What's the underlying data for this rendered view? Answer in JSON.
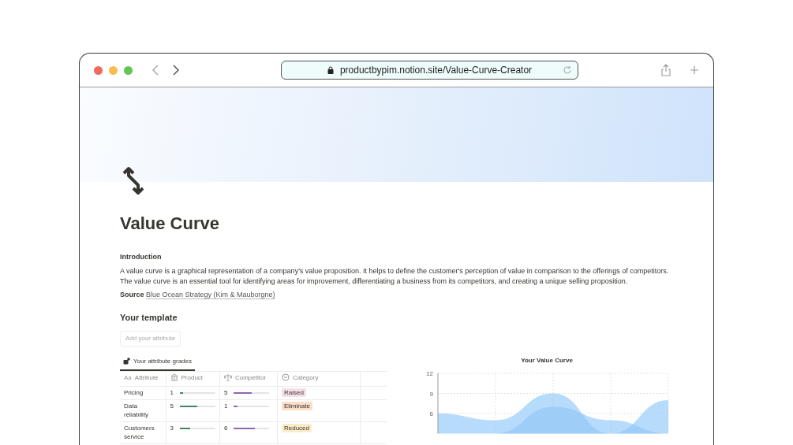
{
  "browser": {
    "url": "productbypim.notion.site/Value-Curve-Creator"
  },
  "page": {
    "title": "Value Curve",
    "intro_heading": "Introduction",
    "intro_text": "A value curve is a graphical representation of a company's value proposition. It helps to define the customer's perception of value in comparison to the offerings of competitors. The value curve is an essential tool for identifying areas for improvement, differentiating a business from its competitors, and creating a unique selling proposition.",
    "source_label": "Source",
    "source_link": "Blue Ocean Strategy (Kim & Mauborgne)"
  },
  "template": {
    "heading": "Your template",
    "button": "Add your attribute",
    "view_tab": "Your attribute grades",
    "columns": [
      {
        "glyph": "Aa",
        "label": "Attribute"
      },
      {
        "label": "Product"
      },
      {
        "label": "Competitor"
      },
      {
        "label": "Category"
      }
    ],
    "rows": [
      {
        "attribute": "Pricing",
        "product": {
          "value": "1",
          "level": 0.1
        },
        "competitor": {
          "value": "5",
          "level": 0.5
        },
        "category": "Raised",
        "color": "#f5e0e9"
      },
      {
        "attribute": "Data reliability",
        "product": {
          "value": "5",
          "level": 0.5
        },
        "competitor": {
          "value": "1",
          "level": 0.1
        },
        "category": "Eliminate",
        "color": "#fadec9"
      },
      {
        "attribute": "Customers service",
        "product": {
          "value": "3",
          "level": 0.3
        },
        "competitor": {
          "value": "6",
          "level": 0.6
        },
        "category": "Reduced",
        "color": "#fbecc8"
      }
    ]
  },
  "chart": {
    "title": "Your Value Curve",
    "tick_labels": [
      "12",
      "9",
      "6"
    ]
  }
}
